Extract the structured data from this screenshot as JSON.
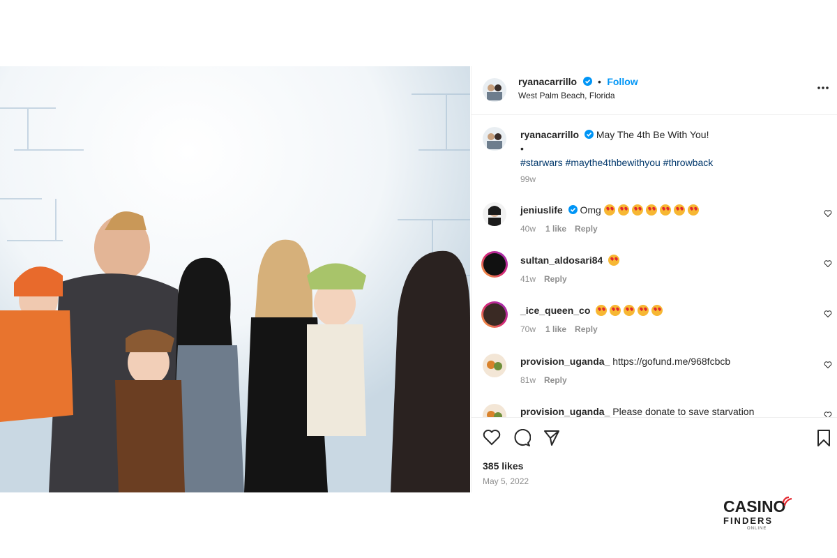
{
  "post": {
    "username": "ryanacarrillo",
    "follow_label": "Follow",
    "dot": "•",
    "location": "West Palm Beach, Florida",
    "more_icon": "more-horizontal-icon"
  },
  "caption": {
    "username": "ryanacarrillo",
    "text": "May The 4th Be With You!",
    "bullet": "•",
    "hashtags": "#starwars #maythe4thbewithyou #throwback",
    "time": "99w"
  },
  "comments": [
    {
      "username": "jeniuslife",
      "text": "Omg",
      "emoji_count": 7,
      "time": "40w",
      "likes": "1 like",
      "reply": "Reply"
    },
    {
      "username": "sultan_aldosari84",
      "text": "",
      "emoji_count": 1,
      "time": "41w",
      "likes": "",
      "reply": "Reply"
    },
    {
      "username": "_ice_queen_co",
      "text": "",
      "emoji_count": 5,
      "time": "70w",
      "likes": "1 like",
      "reply": "Reply"
    },
    {
      "username": "provision_uganda_",
      "text": "https://gofund.me/968fcbcb",
      "emoji_count": 0,
      "time": "81w",
      "likes": "",
      "reply": "Reply"
    },
    {
      "username": "provision_uganda_",
      "text": "Please donate to save starvation",
      "emoji_count": 0,
      "time": "",
      "likes": "",
      "reply": ""
    }
  ],
  "actions": {
    "likes": "385 likes",
    "date": "May 5, 2022"
  },
  "brand": {
    "line1": "CASINO",
    "line2": "FINDERS",
    "line3": "ONLINE"
  },
  "colors": {
    "link_blue": "#0095f6",
    "verified_blue": "#0095f6",
    "hashtag": "#00376b",
    "brand_red": "#e3262e"
  }
}
